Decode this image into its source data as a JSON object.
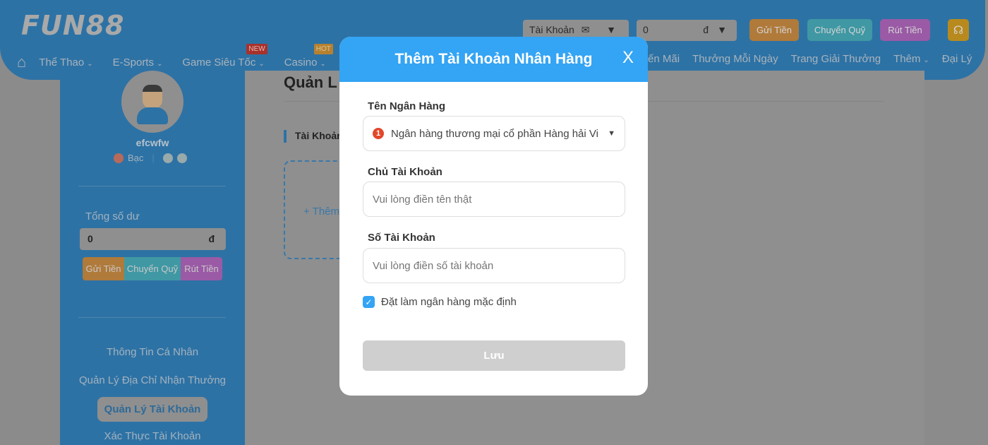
{
  "header": {
    "logo": "FUN88",
    "nav": [
      {
        "label": "Thể Thao"
      },
      {
        "label": "E-Sports"
      },
      {
        "label": "Game Siêu Tốc",
        "badge": "NEW"
      },
      {
        "label": "Casino",
        "badge": "HOT"
      }
    ],
    "nav_right": [
      {
        "label": "ến Mãi"
      },
      {
        "label": "Thưởng Mỗi Ngày"
      },
      {
        "label": "Trang Giải Thưởng"
      },
      {
        "label": "Thêm"
      },
      {
        "label": "Đại Lý"
      }
    ],
    "account": "Tài Khoản",
    "balance": "0",
    "currency": "đ",
    "deposit": "Gửi Tiền",
    "transfer": "Chuyển Quỹ",
    "withdraw": "Rút Tiền",
    "colors": {
      "deposit": "#b07a3a",
      "transfer": "#3f98a3",
      "withdraw": "#9a5aa5",
      "support": "#b88a1e"
    }
  },
  "sidebar": {
    "username": "efcwfw",
    "level": "Bạc",
    "balance_label": "Tổng số dư",
    "balance": "0",
    "currency": "đ",
    "deposit": "Gửi Tiền",
    "transfer": "Chuyển Quỹ",
    "withdraw": "Rút Tiền",
    "menu": [
      "Thông Tin Cá Nhân",
      "Quản Lý Địa Chỉ Nhận Thưởng",
      "Quản Lý Tài Khoản",
      "Xác Thực Tài Khoản"
    ]
  },
  "main": {
    "title": "Quản L",
    "section": "Tài Khoản",
    "add": "+ Thêm"
  },
  "modal": {
    "title": "Thêm Tài Khoản Nhân Hàng",
    "close": "X",
    "bank_label": "Tên Ngân Hàng",
    "bank_value": "Ngân hàng thương mại cổ phần Hàng hải Vi",
    "holder_label": "Chủ Tài Khoản",
    "holder_placeholder": "Vui lòng điền tên thật",
    "number_label": "Số Tài Khoản",
    "number_placeholder": "Vui lòng điền số tài khoản",
    "default_label": "Đặt làm ngân hàng mặc định",
    "default_checked": true,
    "save": "Lưu",
    "accent": "#34a4f4"
  }
}
